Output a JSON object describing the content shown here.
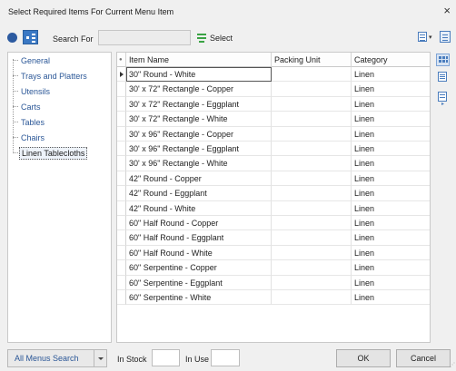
{
  "window": {
    "title": "Select Required Items  For Current Menu Item",
    "close_glyph": "×"
  },
  "toolbar": {
    "circle_icon": "circle-icon",
    "tree_icon": "tree-view-icon",
    "search_label": "Search For",
    "search_value": "",
    "select_label": "Select",
    "select_icon": "filter-lines-icon",
    "right_icon_1": "export-icon",
    "right_caret": "▾",
    "right_icon_2": "form-view-icon",
    "accent_color": "#2b5797"
  },
  "tree": {
    "items": [
      {
        "label": "General"
      },
      {
        "label": "Trays and Platters"
      },
      {
        "label": "Utensils"
      },
      {
        "label": "Carts"
      },
      {
        "label": "Tables"
      },
      {
        "label": "Chairs"
      },
      {
        "label": "Linen Tablecloths"
      }
    ],
    "selected_index": 6
  },
  "grid": {
    "columns": [
      "Item Name",
      "Packing Unit",
      "Category"
    ],
    "selected_row": 0,
    "rows": [
      {
        "name": "30\" Round - White",
        "packing": "",
        "category": "Linen"
      },
      {
        "name": "30' x 72\" Rectangle - Copper",
        "packing": "",
        "category": "Linen"
      },
      {
        "name": "30' x 72\" Rectangle - Eggplant",
        "packing": "",
        "category": "Linen"
      },
      {
        "name": "30' x 72\" Rectangle - White",
        "packing": "",
        "category": "Linen"
      },
      {
        "name": "30' x 96\" Rectangle - Copper",
        "packing": "",
        "category": "Linen"
      },
      {
        "name": "30' x 96\" Rectangle - Eggplant",
        "packing": "",
        "category": "Linen"
      },
      {
        "name": "30' x 96\" Rectangle - White",
        "packing": "",
        "category": "Linen"
      },
      {
        "name": "42\" Round - Copper",
        "packing": "",
        "category": "Linen"
      },
      {
        "name": "42\" Round - Eggplant",
        "packing": "",
        "category": "Linen"
      },
      {
        "name": "42\" Round - White",
        "packing": "",
        "category": "Linen"
      },
      {
        "name": "60\" Half Round - Copper",
        "packing": "",
        "category": "Linen"
      },
      {
        "name": "60\" Half Round - Eggplant",
        "packing": "",
        "category": "Linen"
      },
      {
        "name": "60\" Half Round - White",
        "packing": "",
        "category": "Linen"
      },
      {
        "name": "60\" Serpentine - Copper",
        "packing": "",
        "category": "Linen"
      },
      {
        "name": "60\" Serpentine - Eggplant",
        "packing": "",
        "category": "Linen"
      },
      {
        "name": "60\" Serpentine - White",
        "packing": "",
        "category": "Linen"
      }
    ]
  },
  "side_buttons": [
    "grid-view-icon",
    "detail-view-icon",
    "form-layout-icon"
  ],
  "bottom": {
    "menus_button_label": "All Menus Search",
    "in_stock_label": "In Stock",
    "in_stock_value": "",
    "in_use_label": "In Use",
    "in_use_value": "",
    "ok_label": "OK",
    "cancel_label": "Cancel"
  }
}
